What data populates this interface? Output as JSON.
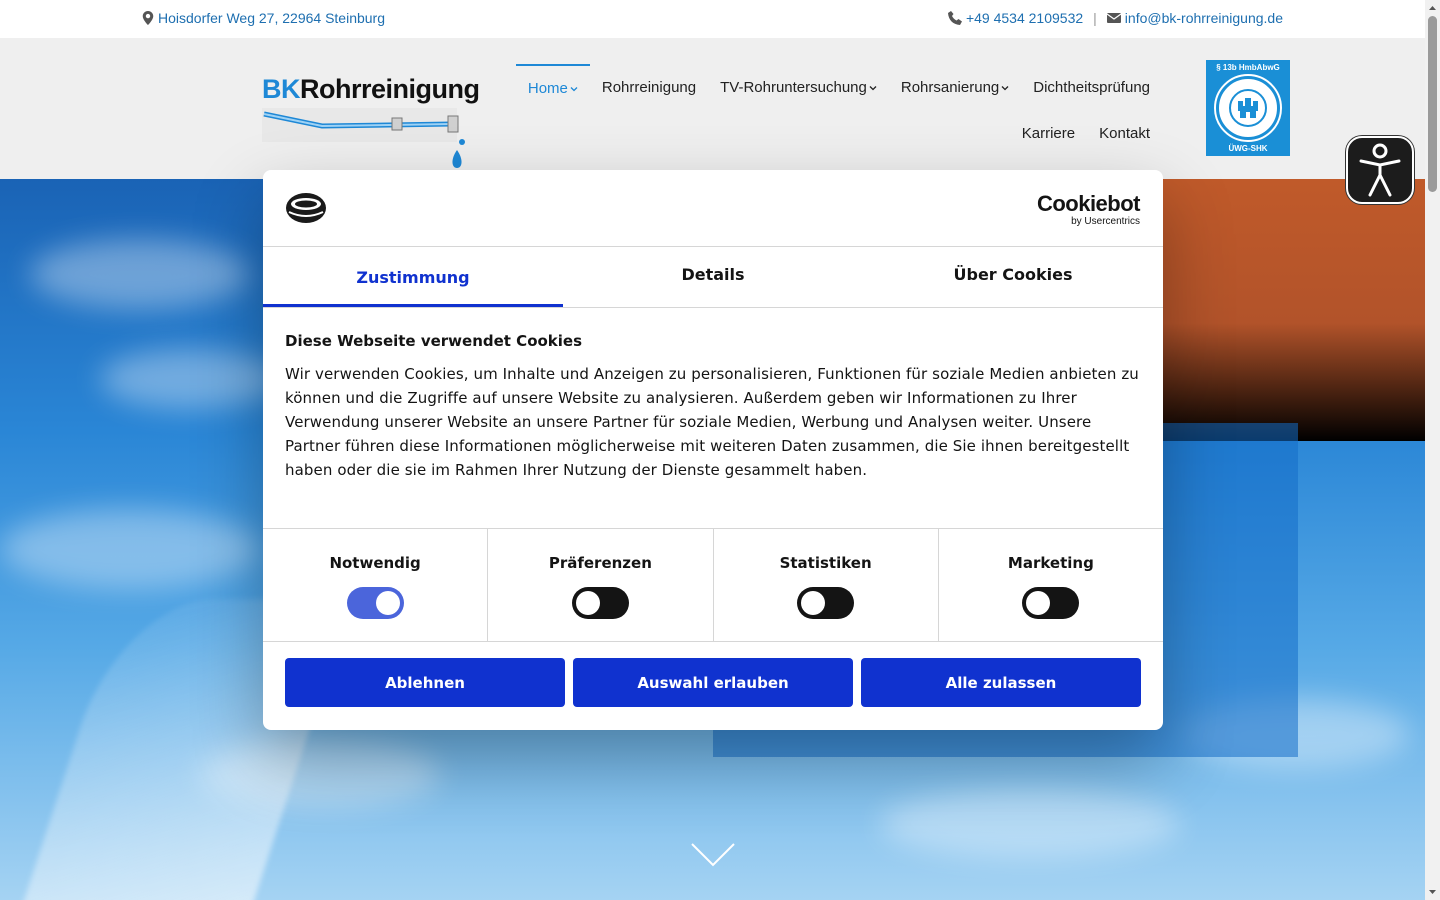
{
  "topbar": {
    "address": "Hoisdorfer Weg 27, 22964 Steinburg",
    "phone": "+49 4534 2109532",
    "separator": "|",
    "email": "info@bk-rohrreinigung.de"
  },
  "logo": {
    "prefix": "BK",
    "name": "Rohrreinigung"
  },
  "nav": {
    "row1": [
      {
        "label": "Home",
        "active": true,
        "dropdown": true
      },
      {
        "label": "Rohrreinigung",
        "active": false,
        "dropdown": false
      },
      {
        "label": "TV-Rohruntersuchung",
        "active": false,
        "dropdown": true
      },
      {
        "label": "Rohrsanierung",
        "active": false,
        "dropdown": true
      },
      {
        "label": "Dichtheitsprüfung",
        "active": false,
        "dropdown": false
      }
    ],
    "row2": [
      {
        "label": "Karriere"
      },
      {
        "label": "Kontakt"
      }
    ]
  },
  "seal": {
    "top": "§ 13b HmbAbwG",
    "bottom": "ÜWG-SHK"
  },
  "cookie": {
    "brand": "Cookiebot",
    "brand_sub": "by Usercentrics",
    "tabs": [
      "Zustimmung",
      "Details",
      "Über Cookies"
    ],
    "title": "Diese Webseite verwendet Cookies",
    "text": "Wir verwenden Cookies, um Inhalte und Anzeigen zu personalisieren, Funktionen für soziale Medien anbieten zu können und die Zugriffe auf unsere Website zu analysieren. Außerdem geben wir Informationen zu Ihrer Verwendung unserer Website an unsere Partner für soziale Medien, Werbung und Analysen weiter. Unsere Partner führen diese Informationen möglicherweise mit weiteren Daten zusammen, die Sie ihnen bereitgestellt haben oder die sie im Rahmen Ihrer Nutzung der Dienste gesammelt haben.",
    "consents": [
      {
        "label": "Notwendig",
        "on": true
      },
      {
        "label": "Präferenzen",
        "on": false
      },
      {
        "label": "Statistiken",
        "on": false
      },
      {
        "label": "Marketing",
        "on": false
      }
    ],
    "buttons": {
      "decline": "Ablehnen",
      "allow_selection": "Auswahl erlauben",
      "allow_all": "Alle zulassen"
    }
  },
  "colors": {
    "accent_blue": "#1e88d6",
    "cookiebot_blue": "#1032cf",
    "header_bg": "#efefef"
  }
}
